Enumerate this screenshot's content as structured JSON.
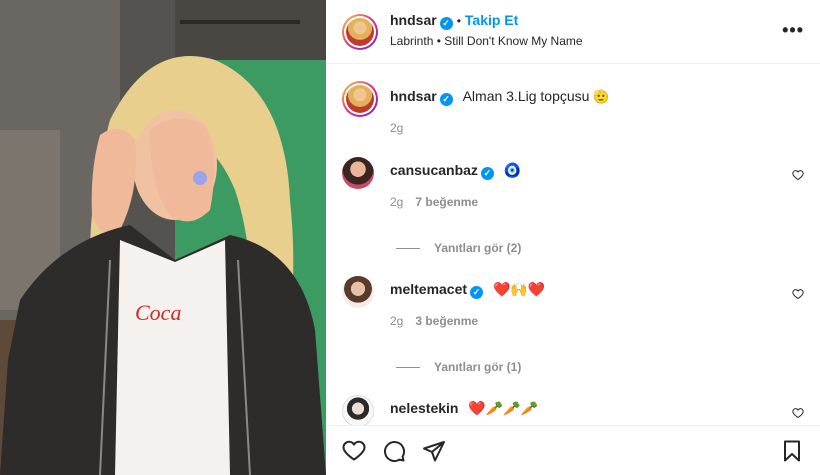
{
  "post": {
    "username": "hndsar",
    "separator": "•",
    "follow_label": "Takip Et",
    "audio": "Labrinth • Still Don't Know My Name",
    "more_icon": "more-options-icon"
  },
  "caption": {
    "username": "hndsar",
    "text": "Alman 3.Lig topçusu",
    "emoji": "🫡",
    "time": "2g"
  },
  "comments": [
    {
      "username": "cansucanbaz",
      "text": "🧿",
      "time": "2g",
      "likes": "7 beğenme",
      "replies": "Yanıtları gör (2)"
    },
    {
      "username": "meltemacet",
      "text": "❤️🙌❤️",
      "time": "2g",
      "likes": "3 beğenme",
      "replies": "Yanıtları gör (1)"
    },
    {
      "username": "nelestekin",
      "text": "❤️🥕🥕🥕"
    }
  ],
  "actions": {
    "like": "heart-icon",
    "comment": "comment-icon",
    "share": "share-icon",
    "save": "bookmark-icon"
  },
  "colors": {
    "accent": "#0095f6",
    "text": "#262626",
    "muted": "#8e8e8e",
    "photo_green": "#3fa56a"
  }
}
